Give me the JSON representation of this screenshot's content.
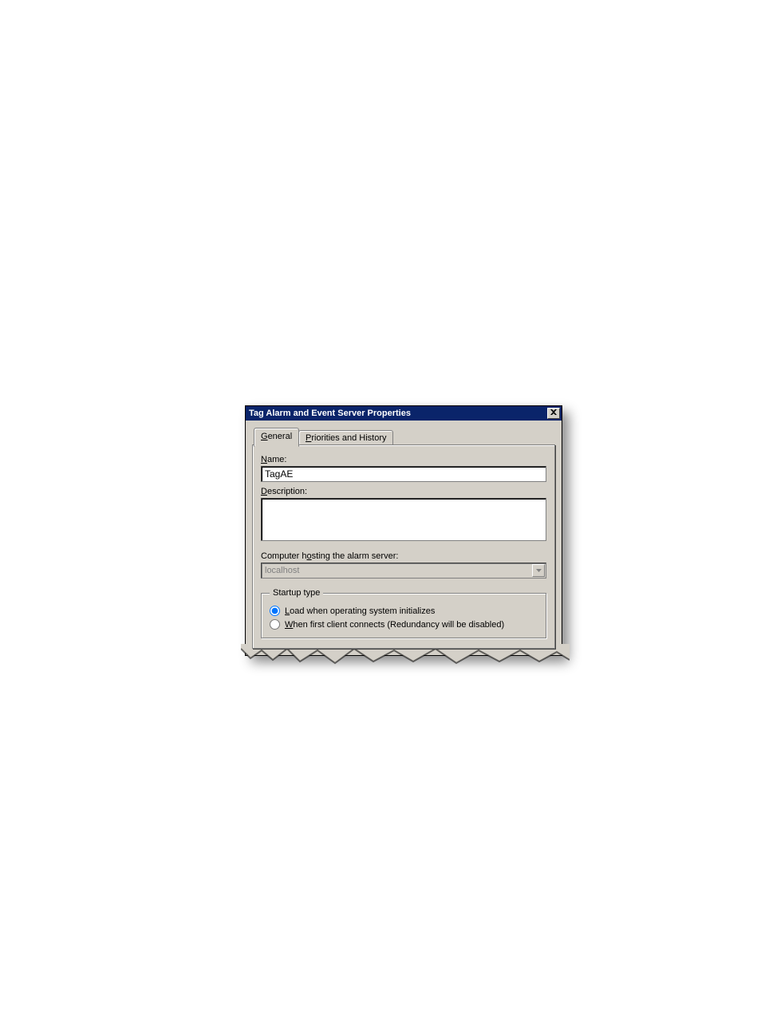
{
  "dialog": {
    "title": "Tag Alarm and Event Server Properties",
    "tabs": [
      {
        "label_pre": "",
        "label_ul": "G",
        "label_post": "eneral"
      },
      {
        "label_pre": "",
        "label_ul": "P",
        "label_post": "riorities and History"
      }
    ],
    "general": {
      "name_label_pre": "",
      "name_label_ul": "N",
      "name_label_post": "ame:",
      "name_value": "TagAE",
      "description_label_pre": "",
      "description_label_ul": "D",
      "description_label_post": "escription:",
      "description_value": "",
      "host_label_pre": "Computer h",
      "host_label_ul": "o",
      "host_label_post": "sting the alarm server:",
      "host_value": "localhost",
      "startup_legend": "Startup type",
      "radio_load_pre": "",
      "radio_load_ul": "L",
      "radio_load_post": "oad when operating system initializes",
      "radio_client_pre": "",
      "radio_client_ul": "W",
      "radio_client_post": "hen first client connects (Redundancy will be disabled)"
    }
  }
}
